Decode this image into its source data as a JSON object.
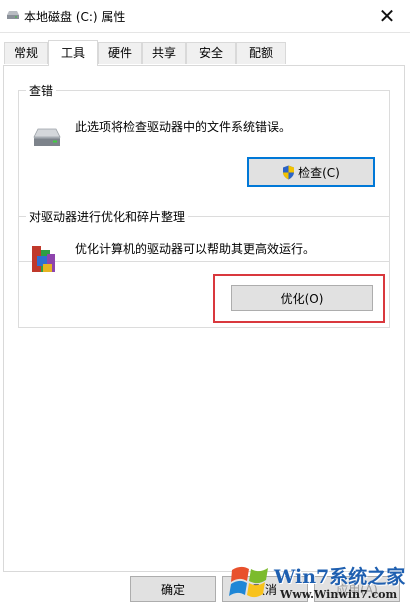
{
  "window": {
    "title": "本地磁盘 (C:) 属性",
    "close_glyph": "✕"
  },
  "tabs": [
    {
      "label": "常规",
      "active": false
    },
    {
      "label": "工具",
      "active": true
    },
    {
      "label": "硬件",
      "active": false
    },
    {
      "label": "共享",
      "active": false
    },
    {
      "label": "安全",
      "active": false
    },
    {
      "label": "配额",
      "active": false
    }
  ],
  "error_check": {
    "title": "查错",
    "description": "此选项将检查驱动器中的文件系统错误。",
    "button_label": "检查(C)",
    "icon": "drive-icon",
    "button_icon": "uac-shield-icon"
  },
  "optimize": {
    "title": "对驱动器进行优化和碎片整理",
    "description": "优化计算机的驱动器可以帮助其更高效运行。",
    "button_label": "优化(O)",
    "icon": "defrag-icon",
    "highlight_color": "#d9383d"
  },
  "footer": {
    "ok_label": "确定",
    "cancel_label": "取消",
    "apply_label": "应用(A)"
  },
  "watermark": {
    "brand": "Win7系统之家",
    "url": "Www.Winwin7.com"
  },
  "colors": {
    "focus_border": "#0078d7",
    "button_face": "#e1e1e1"
  }
}
